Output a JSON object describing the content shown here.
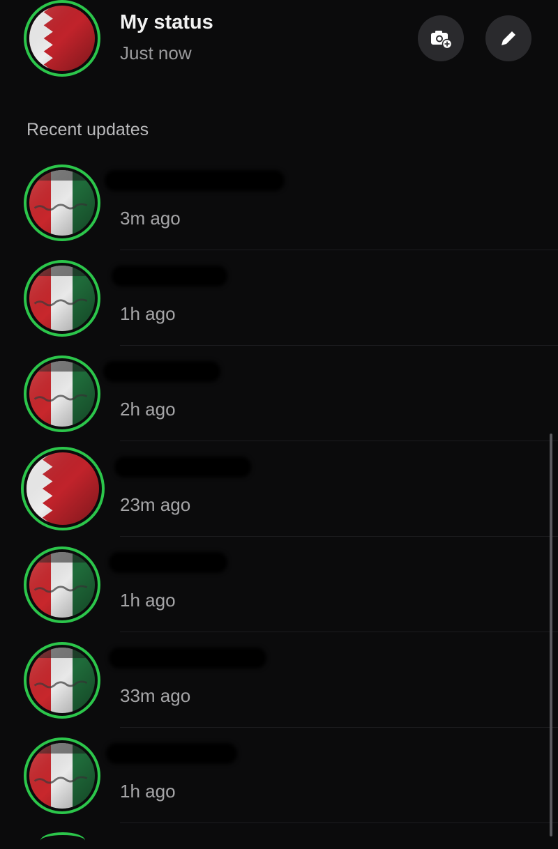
{
  "my_status": {
    "name": "My status",
    "time": "Just now",
    "avatar_icon": "bahrain-flag-icon"
  },
  "actions": {
    "camera_icon": "camera-add-icon",
    "edit_icon": "pencil-icon"
  },
  "recent": {
    "title": "Recent updates",
    "items": [
      {
        "name": "",
        "time": "3m ago",
        "avatar": "flag-red-white-green"
      },
      {
        "name": "",
        "time": "1h ago",
        "avatar": "flag-red-white-green"
      },
      {
        "name": "",
        "time": "2h ago",
        "avatar": "flag-red-white-green"
      },
      {
        "name": "",
        "time": "23m ago",
        "avatar": "bahrain-flag"
      },
      {
        "name": "",
        "time": "1h ago",
        "avatar": "flag-red-white-green"
      },
      {
        "name": "",
        "time": "33m ago",
        "avatar": "flag-red-white-green"
      },
      {
        "name": "",
        "time": "1h ago",
        "avatar": "flag-red-white-green"
      }
    ]
  },
  "colors": {
    "background": "#0b0b0c",
    "ring": "#2cc64b",
    "secondary_text": "#9a9a9c",
    "button_bg": "#2a2a2d"
  }
}
